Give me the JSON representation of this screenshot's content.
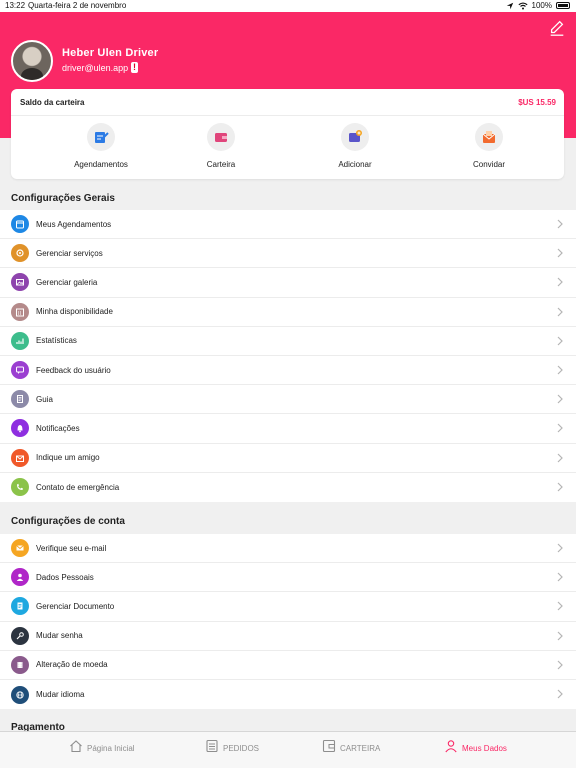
{
  "status_bar": {
    "time": "13:22",
    "date": "Quarta-feira 2 de novembro",
    "battery": "100%"
  },
  "profile": {
    "name": "Heber Ulen Driver",
    "email": "driver@ulen.app"
  },
  "wallet": {
    "label": "Saldo da carteira",
    "amount": "$US 15.59",
    "actions": [
      {
        "label": "Agendamentos",
        "icon": "calendar-edit-icon",
        "color": "#2c7be5"
      },
      {
        "label": "Carteira",
        "icon": "wallet-icon",
        "color": "#e0457b"
      },
      {
        "label": "Adicionar",
        "icon": "wallet-add-icon",
        "color": "#5a55c9"
      },
      {
        "label": "Convidar",
        "icon": "invite-mail-icon",
        "color": "#f26a2e"
      }
    ]
  },
  "sections": {
    "general": {
      "title": "Configurações Gerais",
      "items": [
        {
          "label": "Meus Agendamentos",
          "icon": "calendar-icon",
          "color": "#1e88e5"
        },
        {
          "label": "Gerenciar serviços",
          "icon": "services-icon",
          "color": "#e0922a"
        },
        {
          "label": "Gerenciar galeria",
          "icon": "gallery-icon",
          "color": "#8e44ad"
        },
        {
          "label": "Minha disponibilidade",
          "icon": "availability-icon",
          "color": "#b48a8a"
        },
        {
          "label": "Estatísticas",
          "icon": "statistics-icon",
          "color": "#3dbd8c"
        },
        {
          "label": "Feedback do usuário",
          "icon": "feedback-icon",
          "color": "#9b3fd1"
        },
        {
          "label": "Guia",
          "icon": "guide-icon",
          "color": "#8c8aa8"
        },
        {
          "label": "Notificações",
          "icon": "bell-icon",
          "color": "#8e2ee0"
        },
        {
          "label": "Indique um amigo",
          "icon": "refer-friend-icon",
          "color": "#f0592a"
        },
        {
          "label": "Contato de emergência",
          "icon": "emergency-phone-icon",
          "color": "#8bc34a"
        }
      ]
    },
    "account": {
      "title": "Configurações de conta",
      "items": [
        {
          "label": "Verifique seu e-mail",
          "icon": "email-icon",
          "color": "#f5a623"
        },
        {
          "label": "Dados Pessoais",
          "icon": "person-icon",
          "color": "#b026c8"
        },
        {
          "label": "Gerenciar Documento",
          "icon": "document-icon",
          "color": "#1ea8e0"
        },
        {
          "label": "Mudar senha",
          "icon": "key-icon",
          "color": "#2c3440"
        },
        {
          "label": "Alteração de moeda",
          "icon": "currency-icon",
          "color": "#8a5a8c"
        },
        {
          "label": "Mudar idioma",
          "icon": "globe-icon",
          "color": "#1f4e79"
        }
      ]
    },
    "payment": {
      "title": "Pagamento"
    }
  },
  "tabbar": {
    "tabs": [
      {
        "label": "Página Inicial",
        "icon": "home-icon"
      },
      {
        "label": "PEDIDOS",
        "icon": "orders-icon"
      },
      {
        "label": "CARTEIRA",
        "icon": "wallet-tab-icon"
      },
      {
        "label": "Meus Dados",
        "icon": "profile-tab-icon",
        "active": true
      }
    ]
  },
  "colors": {
    "brand": "#fa2866",
    "background": "#f0f0f0"
  }
}
